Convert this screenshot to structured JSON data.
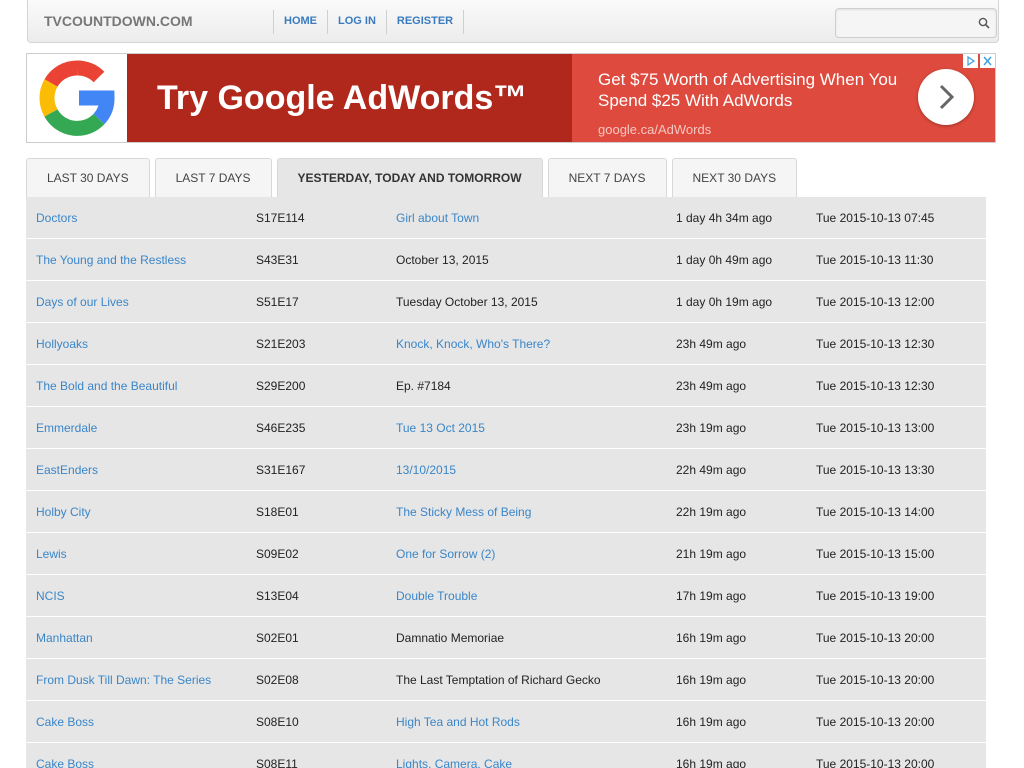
{
  "navbar": {
    "brand": "TVCOUNTDOWN.COM",
    "links": [
      "HOME",
      "LOG IN",
      "REGISTER"
    ],
    "search_placeholder": ""
  },
  "ad": {
    "headline": "Try Google AdWords™",
    "description": "Get $75 Worth of Advertising When You Spend $25 With AdWords",
    "url": "google.ca/AdWords",
    "left_color": "#b0281b",
    "right_color": "#de4a3d"
  },
  "tabs": [
    "LAST 30 DAYS",
    "LAST 7 DAYS",
    "YESTERDAY, TODAY AND TOMORROW",
    "NEXT 7 DAYS",
    "NEXT 30 DAYS"
  ],
  "active_tab": "YESTERDAY, TODAY AND TOMORROW",
  "episodes": [
    {
      "show": "Doctors",
      "episode": "S17E114",
      "title": "Girl about Town",
      "title_link": true,
      "ago": "1 day 4h 34m ago",
      "date": "Tue 2015-10-13  07:45"
    },
    {
      "show": "The Young and the Restless",
      "episode": "S43E31",
      "title": "October 13, 2015",
      "title_link": false,
      "ago": "1 day 0h 49m ago",
      "date": "Tue 2015-10-13  11:30"
    },
    {
      "show": "Days of our Lives",
      "episode": "S51E17",
      "title": "Tuesday October 13, 2015",
      "title_link": false,
      "ago": "1 day 0h 19m ago",
      "date": "Tue 2015-10-13  12:00"
    },
    {
      "show": "Hollyoaks",
      "episode": "S21E203",
      "title": "Knock, Knock, Who's There?",
      "title_link": true,
      "ago": "23h 49m ago",
      "date": "Tue 2015-10-13  12:30"
    },
    {
      "show": "The Bold and the Beautiful",
      "episode": "S29E200",
      "title": "Ep. #7184",
      "title_link": false,
      "ago": "23h 49m ago",
      "date": "Tue 2015-10-13  12:30"
    },
    {
      "show": "Emmerdale",
      "episode": "S46E235",
      "title": "Tue 13 Oct 2015",
      "title_link": true,
      "ago": "23h 19m ago",
      "date": "Tue 2015-10-13  13:00"
    },
    {
      "show": "EastEnders",
      "episode": "S31E167",
      "title": "13/10/2015",
      "title_link": true,
      "ago": "22h 49m ago",
      "date": "Tue 2015-10-13  13:30"
    },
    {
      "show": "Holby City",
      "episode": "S18E01",
      "title": "The Sticky Mess of Being",
      "title_link": true,
      "ago": "22h 19m ago",
      "date": "Tue 2015-10-13  14:00"
    },
    {
      "show": "Lewis",
      "episode": "S09E02",
      "title": "One for Sorrow (2)",
      "title_link": true,
      "ago": "21h 19m ago",
      "date": "Tue 2015-10-13  15:00"
    },
    {
      "show": "NCIS",
      "episode": "S13E04",
      "title": "Double Trouble",
      "title_link": true,
      "ago": "17h 19m ago",
      "date": "Tue 2015-10-13  19:00"
    },
    {
      "show": "Manhattan",
      "episode": "S02E01",
      "title": "Damnatio Memoriae",
      "title_link": false,
      "ago": "16h 19m ago",
      "date": "Tue 2015-10-13  20:00"
    },
    {
      "show": "From Dusk Till Dawn: The Series",
      "episode": "S02E08",
      "title": "The Last Temptation of Richard Gecko",
      "title_link": false,
      "ago": "16h 19m ago",
      "date": "Tue 2015-10-13  20:00"
    },
    {
      "show": "Cake Boss",
      "episode": "S08E10",
      "title": "High Tea and Hot Rods",
      "title_link": true,
      "ago": "16h 19m ago",
      "date": "Tue 2015-10-13  20:00"
    },
    {
      "show": "Cake Boss",
      "episode": "S08E11",
      "title": "Lights, Camera, Cake",
      "title_link": true,
      "ago": "16h 19m ago",
      "date": "Tue 2015-10-13  20:00"
    }
  ]
}
